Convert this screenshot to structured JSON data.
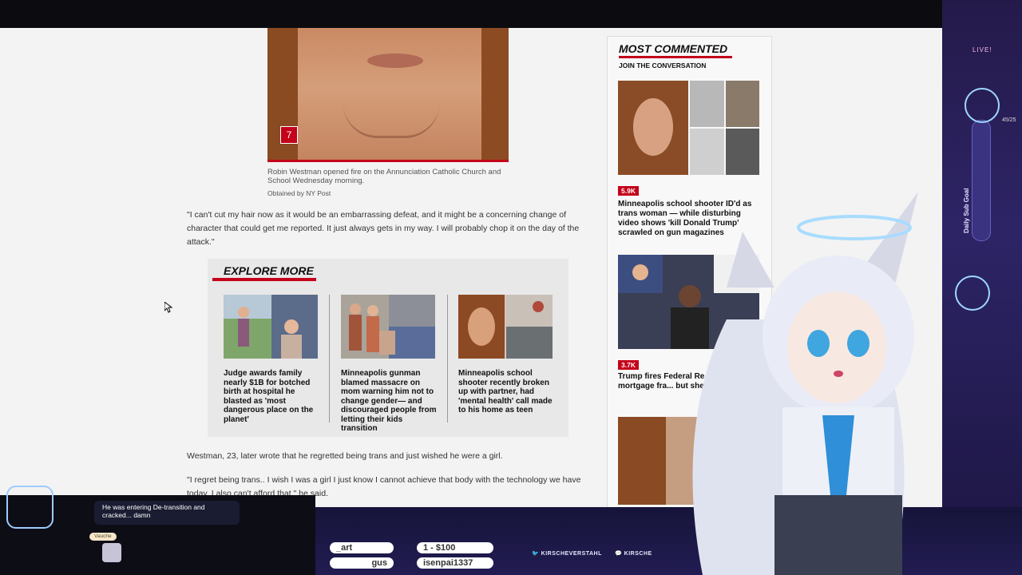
{
  "article": {
    "hero_badge": "7",
    "caption": "Robin Westman opened fire on the Annunciation Catholic Church and School Wednesday morning.",
    "credit": "Obtained by NY Post",
    "quote1": "\"I can't cut my hair now as it would be an embarrassing defeat, and it might be a concerning change of character that could get me reported. It just always gets in my way. I will probably chop it on the day of the attack.\"",
    "para2": "Westman, 23, later wrote that he regretted being trans and just wished he were a girl.",
    "quote2": "\"I regret being trans.. I wish I was a girl I just know I cannot achieve that body with the technology we have today. I also can't afford that,\" he said."
  },
  "explore": {
    "title": "EXPLORE MORE",
    "items": [
      {
        "headline": "Judge awards family nearly $1B for botched birth at hospital he blasted as 'most dangerous place on the planet'"
      },
      {
        "headline": "Minneapolis gunman blamed massacre on mom warning him not to change gender— and discouraged people from letting their kids transition"
      },
      {
        "headline": "Minneapolis school shooter recently broken up with partner, had 'mental health' call made to his home as teen"
      }
    ]
  },
  "sidebar": {
    "title": "MOST COMMENTED",
    "subtitle": "JOIN THE CONVERSATION",
    "items": [
      {
        "count": "5.9K",
        "headline": "Minneapolis school shooter ID'd as trans woman — while disturbing video shows 'kill Donald Trump' scrawled on gun magazines"
      },
      {
        "count": "3.7K",
        "headline": "Trump fires Federal Re... over mortgage fra... but she refuse..."
      }
    ]
  },
  "stream": {
    "live": "LIVE!",
    "sub_count": "45/25",
    "sub_goal": "Daily Sub Goal",
    "chat_message": "He was entering De-transition and cracked... damn",
    "chat_user": "Vauche",
    "ticker": [
      "_art",
      "gus",
      "1 - $100",
      "isenpai1337"
    ],
    "socials": [
      "KIRSCHEVERSTAHL",
      "KIRSCHE"
    ]
  },
  "colors": {
    "accent": "#c4001a",
    "page_bg": "#f3f3f3",
    "stream_bg": "#221c52"
  }
}
